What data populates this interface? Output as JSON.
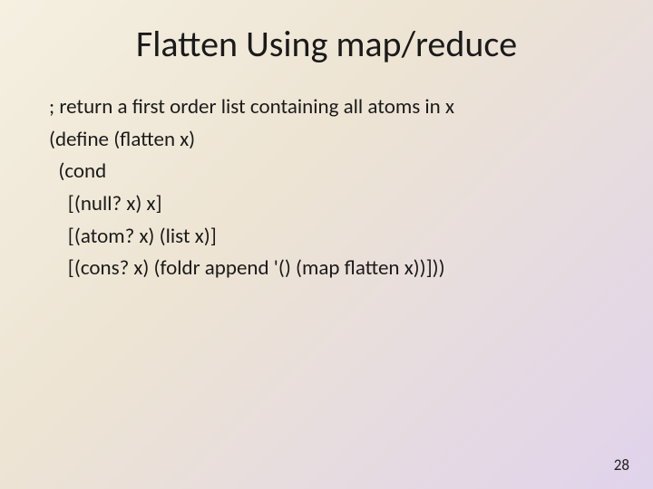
{
  "title": "Flatten Using map/reduce",
  "code": {
    "comment": "; return a first order list containing all atoms in x",
    "l1": "(define (flatten x)",
    "l2": "  (cond",
    "l3": "    [(null? x) x]",
    "l4": "    [(atom? x) (list x)]",
    "l5": "    [(cons? x) (foldr append '() (map flatten x))]))"
  },
  "page_number": "28"
}
